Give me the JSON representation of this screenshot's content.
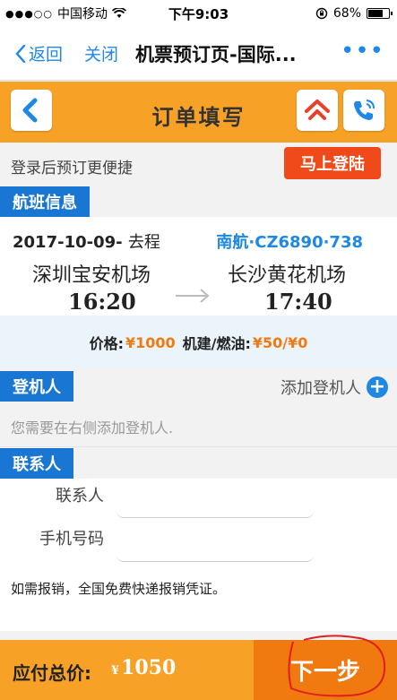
{
  "status_bar": {
    "carrier": "中国移动",
    "time": "下午9:03",
    "battery": "68%",
    "battery_level": 0.68
  },
  "nav": {
    "back_label": "返回",
    "close_label": "关闭",
    "title": "机票预订页-国际...",
    "more": "•••"
  },
  "header": {
    "title": "订单填写",
    "icons": [
      "back-arrow-icon",
      "home-icon",
      "phone-icon"
    ],
    "accent": "#f7a227"
  },
  "login": {
    "text": "登录后预订更便捷",
    "button": "马上登陆"
  },
  "flight_section": {
    "tag": "航班信息",
    "date": "2017-10-09-",
    "trip_type": "去程",
    "flight_no": "南航·CZ6890·738",
    "depart_airport": "深圳宝安机场",
    "depart_time": "16:20",
    "arrive_airport": "长沙黄花机场",
    "arrive_time": "17:40"
  },
  "price": {
    "price_label": "价格:",
    "price_value": "¥1000",
    "fee_label": "机建/燃油:",
    "fee_value": "¥50/¥0"
  },
  "passenger_section": {
    "tag": "登机人",
    "add_label": "添加登机人",
    "hint": "您需要在右侧添加登机人."
  },
  "contact_section": {
    "tag": "联系人",
    "name_label": "联系人",
    "name_value": "",
    "phone_label": "手机号码",
    "phone_value": "",
    "note": "如需报销，全国免费快递报销凭证。"
  },
  "footer": {
    "total_label": "应付总价:",
    "currency": "¥",
    "total_value": "1050",
    "next_label": "下一步"
  },
  "colors": {
    "orange": "#f7a227",
    "orange_dark": "#f07a10",
    "blue": "#1976d2",
    "red_button": "#f04a1a"
  }
}
